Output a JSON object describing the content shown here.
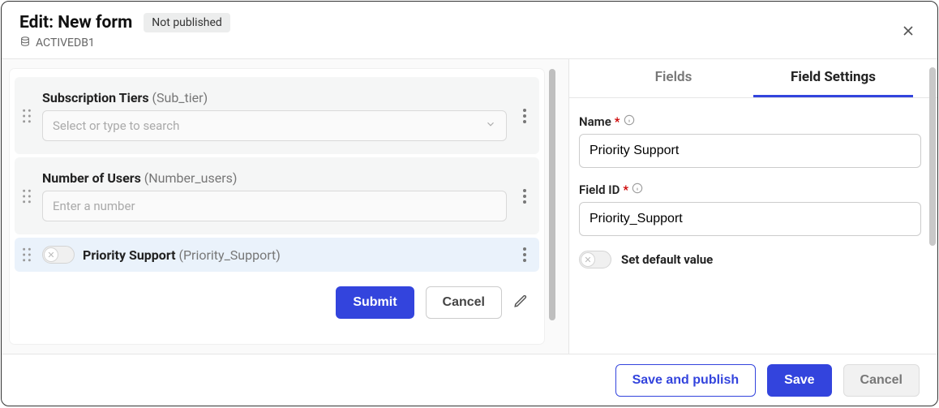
{
  "header": {
    "title": "Edit: New form",
    "status": "Not published",
    "database": "ACTIVEDB1"
  },
  "form": {
    "fields": [
      {
        "label": "Subscription Tiers",
        "id": "Sub_tier",
        "placeholder": "Select or type to search"
      },
      {
        "label": "Number of Users",
        "id": "Number_users",
        "placeholder": "Enter a number"
      },
      {
        "label": "Priority Support",
        "id": "Priority_Support"
      }
    ],
    "submit_label": "Submit",
    "cancel_label": "Cancel"
  },
  "settings": {
    "tabs": {
      "fields": "Fields",
      "field_settings": "Field Settings"
    },
    "labels": {
      "name": "Name",
      "field_id": "Field ID",
      "set_default": "Set default value"
    },
    "required_mark": "*",
    "name_value": "Priority Support",
    "field_id_value": "Priority_Support"
  },
  "footer": {
    "save_publish": "Save and publish",
    "save": "Save",
    "cancel": "Cancel"
  }
}
